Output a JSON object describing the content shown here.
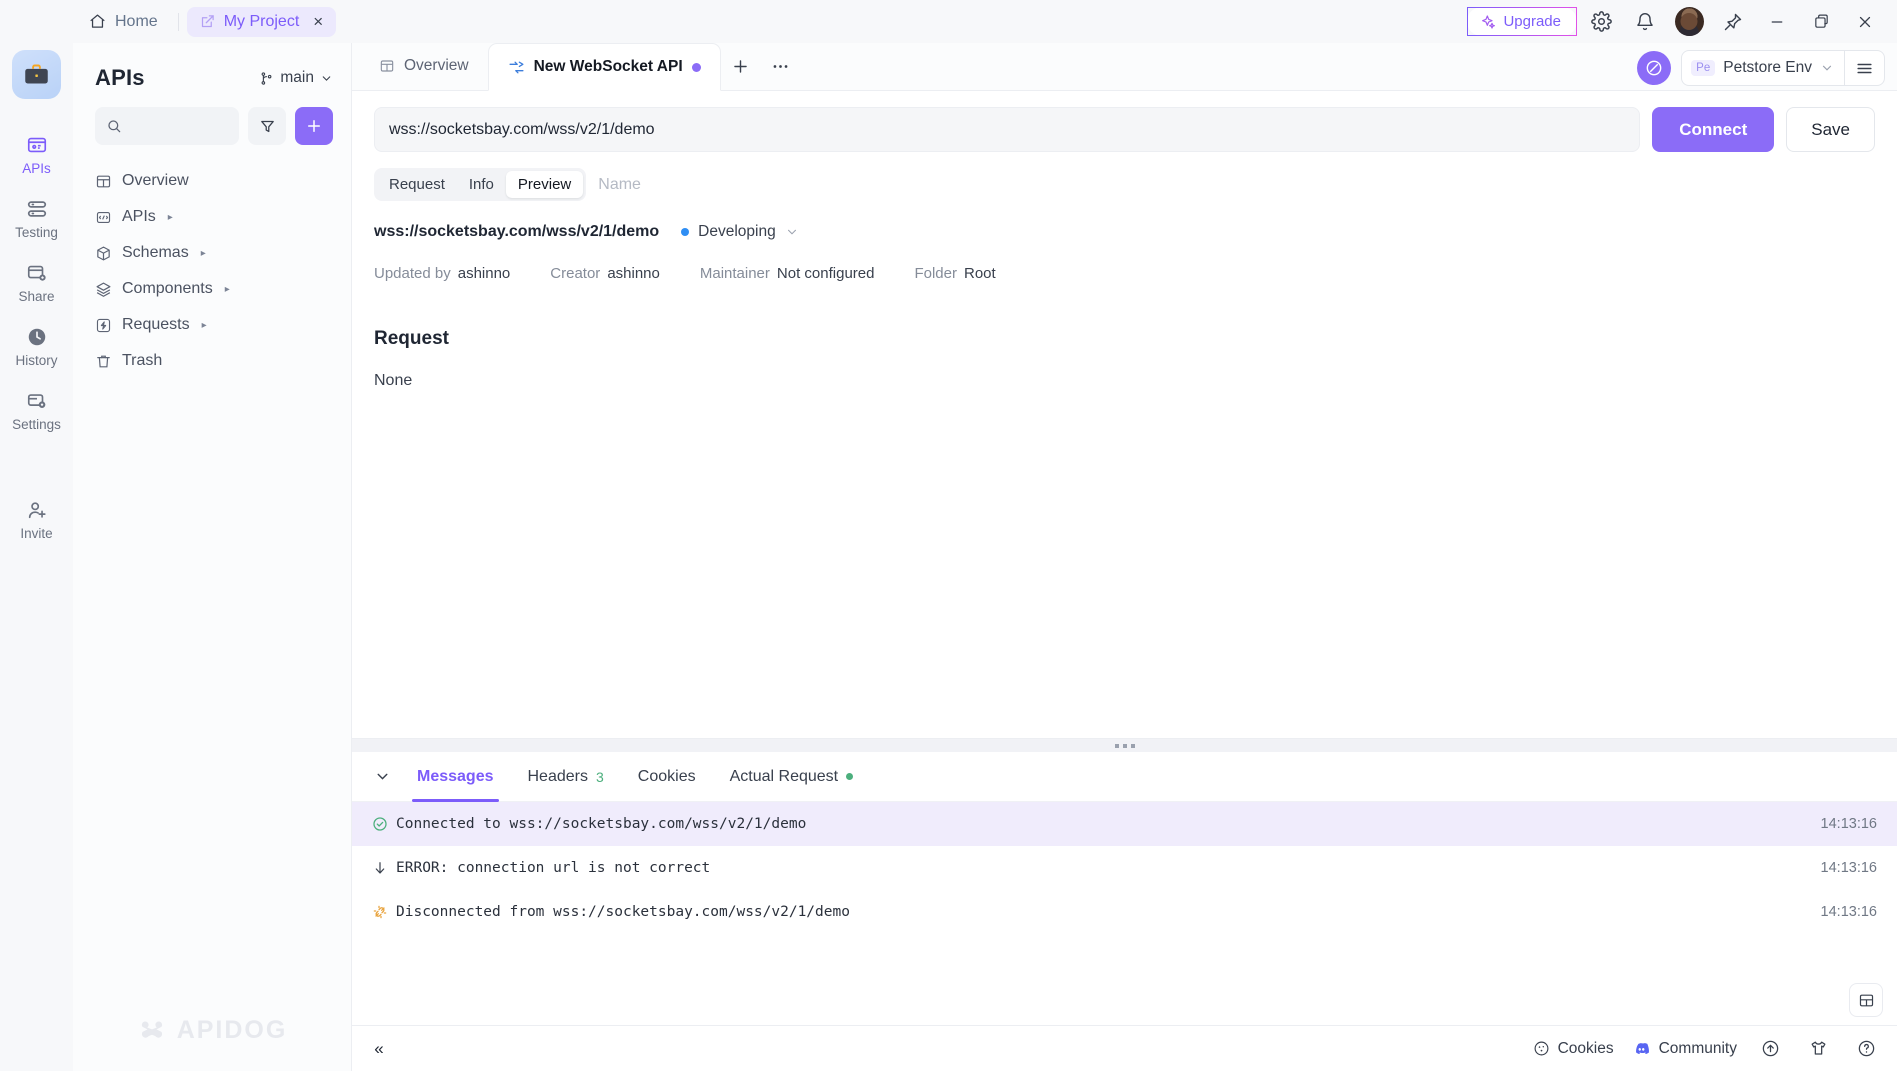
{
  "titlebar": {
    "home_label": "Home",
    "project_label": "My Project",
    "upgrade_label": "Upgrade",
    "icons": {
      "home": "home-icon",
      "project": "external-link-icon",
      "close_tab": "×",
      "settings": "gear-icon",
      "notifications": "bell-icon",
      "pin": "pin-icon",
      "minimize": "−",
      "maximize": "maximize-icon",
      "close": "×"
    }
  },
  "rail": {
    "items": [
      {
        "label": "APIs",
        "icon": "apis-icon",
        "active": true
      },
      {
        "label": "Testing",
        "icon": "testing-icon",
        "active": false
      },
      {
        "label": "Share",
        "icon": "share-icon",
        "active": false
      },
      {
        "label": "History",
        "icon": "history-icon",
        "active": false
      },
      {
        "label": "Settings",
        "icon": "settings-icon",
        "active": false
      },
      {
        "label": "Invite",
        "icon": "invite-icon",
        "active": false
      }
    ]
  },
  "sidebar": {
    "title": "APIs",
    "branch": "main",
    "search_placeholder": "",
    "filter_icon": "filter-icon",
    "add_label": "+",
    "tree": [
      {
        "label": "Overview",
        "icon": "overview-icon",
        "expandable": false
      },
      {
        "label": "APIs",
        "icon": "apis-folder-icon",
        "expandable": true
      },
      {
        "label": "Schemas",
        "icon": "schemas-icon",
        "expandable": true
      },
      {
        "label": "Components",
        "icon": "components-icon",
        "expandable": true
      },
      {
        "label": "Requests",
        "icon": "requests-icon",
        "expandable": true
      },
      {
        "label": "Trash",
        "icon": "trash-icon",
        "expandable": false
      }
    ],
    "watermark": "APIDOG"
  },
  "main": {
    "tabs": [
      {
        "label": "Overview",
        "icon": "overview-icon",
        "active": false,
        "dirty": false
      },
      {
        "label": "New WebSocket API",
        "icon": "websocket-icon",
        "active": true,
        "dirty": true
      }
    ],
    "new_tab_label": "+",
    "more_label": "···",
    "env": {
      "chip": "Pe",
      "name": "Petstore Env",
      "chevron": "⌄",
      "menu_icon": "hamburger-icon",
      "globe_icon": "globe-icon"
    },
    "url": "wss://socketsbay.com/wss/v2/1/demo",
    "url_placeholder": "wss://",
    "connect_label": "Connect",
    "save_label": "Save",
    "segments": [
      {
        "label": "Request",
        "active": false
      },
      {
        "label": "Info",
        "active": false
      },
      {
        "label": "Preview",
        "active": true
      }
    ],
    "name_placeholder": "Name",
    "name_value": ""
  },
  "preview": {
    "url": "wss://socketsbay.com/wss/v2/1/demo",
    "status": "Developing",
    "status_color": "#2f8ef4",
    "meta": [
      {
        "key": "Updated by",
        "value": "ashinno"
      },
      {
        "key": "Creator",
        "value": "ashinno"
      },
      {
        "key": "Maintainer",
        "value": "Not configured"
      },
      {
        "key": "Folder",
        "value": "Root"
      }
    ],
    "section_title": "Request",
    "section_body": "None"
  },
  "bottom": {
    "collapse_icon": "chevron-down-icon",
    "tabs": [
      {
        "label": "Messages",
        "active": true,
        "badge": "",
        "dot": false
      },
      {
        "label": "Headers",
        "active": false,
        "badge": "3",
        "dot": false
      },
      {
        "label": "Cookies",
        "active": false,
        "badge": "",
        "dot": false
      },
      {
        "label": "Actual Request",
        "active": false,
        "badge": "",
        "dot": true
      }
    ],
    "messages": [
      {
        "icon": "check-circle-icon",
        "icon_color": "#4caf7d",
        "text": "Connected to wss://socketsbay.com/wss/v2/1/demo",
        "time": "14:13:16",
        "selected": true
      },
      {
        "icon": "arrow-down-icon",
        "icon_color": "#39404d",
        "text": "ERROR: connection url is not correct",
        "time": "14:13:16",
        "selected": false
      },
      {
        "icon": "disconnect-icon",
        "icon_color": "#e8a33d",
        "text": "Disconnected from wss://socketsbay.com/wss/v2/1/demo",
        "time": "14:13:16",
        "selected": false
      }
    ],
    "layout_toggle_icon": "layout-toggle-icon"
  },
  "statusbar": {
    "collapse_label": "«",
    "cookies_label": "Cookies",
    "community_label": "Community",
    "icons": [
      "upload-circle-icon",
      "shirt-icon",
      "help-circle-icon"
    ]
  }
}
